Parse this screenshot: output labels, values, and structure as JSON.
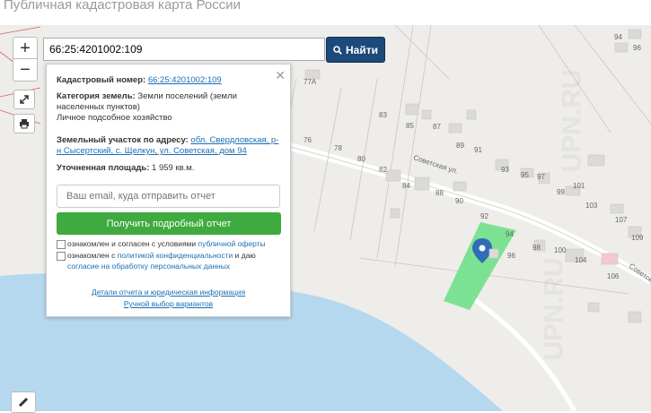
{
  "page_title": "Публичная кадастровая карта России",
  "controls": {
    "zoom_in": "+",
    "zoom_out": "−"
  },
  "search": {
    "value": "66:25:4201002:109",
    "button_label": "Найти"
  },
  "popup": {
    "cadastral_label": "Кадастровый номер:",
    "cadastral_value": "66:25:4201002:109",
    "category_label": "Категория земель:",
    "category_value": "Земли поселений (земли населенных пунктов)",
    "usage": "Личное подсобное хозяйство",
    "address_label": "Земельный участок по адресу:",
    "address_value": "обл. Свердловская, р-н Сысертский, с. Щелкун, ул. Советская, дом 94",
    "area_label": "Уточненная площадь:",
    "area_value": "1 959 кв.м.",
    "email_placeholder": "Ваш email, куда отправить отчет",
    "report_button": "Получить подробный отчет",
    "consent1_text": "ознакомлен и согласен с условиями",
    "consent1_link": "публичной оферты",
    "consent2_text": "ознакомлен с",
    "consent2_link1": "политикой конфиденциальности",
    "consent2_mid": "и даю",
    "consent2_link2": "согласие на обработку персональных данных",
    "details_link": "Детали отчета и юридическая информация",
    "manual_link": "Ручной выбор вариантов"
  },
  "map": {
    "street_label_1": "Советская ул.",
    "street_label_2": "Советская",
    "watermark": "UPN.RU",
    "house_numbers": [
      "77А",
      "83",
      "85",
      "87",
      "89",
      "91",
      "76",
      "78",
      "80",
      "82",
      "84",
      "88",
      "90",
      "92",
      "93",
      "95",
      "97",
      "99",
      "101",
      "103",
      "107",
      "109",
      "94",
      "96",
      "98",
      "100",
      "104",
      "106",
      "94",
      "96"
    ]
  },
  "colors": {
    "parcel": "#6fe08a",
    "water": "#b5d8ef",
    "search_button": "#1c4a7a",
    "report_button": "#3faa3f"
  }
}
